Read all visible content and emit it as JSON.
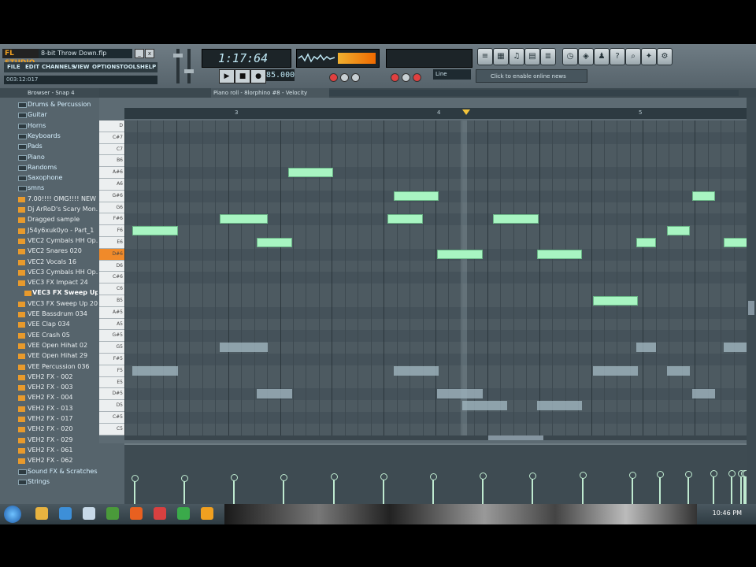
{
  "app": {
    "logo": "FL STUDIO",
    "song_title": "8-bit Throw Down.flp",
    "menu": [
      "FILE",
      "EDIT",
      "CHANNELS",
      "VIEW",
      "OPTIONS",
      "TOOLS",
      "HELP"
    ],
    "time_hint": "003:12:017",
    "time": "1:17:64",
    "tempo": "85.000",
    "line_mode": "Line",
    "online_text": "Click to enable online news"
  },
  "browser": {
    "header": "Browser - Snap 4",
    "items": [
      {
        "label": "Drums & Percussion",
        "type": "folder"
      },
      {
        "label": "Guitar",
        "type": "folder"
      },
      {
        "label": "Horns",
        "type": "folder"
      },
      {
        "label": "Keyboards",
        "type": "folder"
      },
      {
        "label": "Pads",
        "type": "folder"
      },
      {
        "label": "Piano",
        "type": "folder"
      },
      {
        "label": "Randoms",
        "type": "folder"
      },
      {
        "label": "Saxophone",
        "type": "folder"
      },
      {
        "label": "smns",
        "type": "folder"
      },
      {
        "label": "7.00!!!! OMG!!!! NEW ...",
        "type": "file"
      },
      {
        "label": "Dj ArRoD's Scary Mon...",
        "type": "file"
      },
      {
        "label": "Dragged sample",
        "type": "file"
      },
      {
        "label": "J54y6xuk0yo - Part_1",
        "type": "file"
      },
      {
        "label": "VEC2 Cymbals HH Op...",
        "type": "file"
      },
      {
        "label": "VEC2 Snares 020",
        "type": "file"
      },
      {
        "label": "VEC2 Vocals 16",
        "type": "file"
      },
      {
        "label": "VEC3 Cymbals HH Op...",
        "type": "file"
      },
      {
        "label": "VEC3 FX Impact 24",
        "type": "file"
      },
      {
        "label": "VEC3 FX Sweep Up...",
        "type": "file",
        "selected": true
      },
      {
        "label": "VEC3 FX Sweep Up 20",
        "type": "file"
      },
      {
        "label": "VEE Bassdrum 034",
        "type": "file"
      },
      {
        "label": "VEE Clap 034",
        "type": "file"
      },
      {
        "label": "VEE Crash 05",
        "type": "file"
      },
      {
        "label": "VEE Open Hihat 02",
        "type": "file"
      },
      {
        "label": "VEE Open Hihat 29",
        "type": "file"
      },
      {
        "label": "VEE Percussion 036",
        "type": "file"
      },
      {
        "label": "VEH2 FX - 002",
        "type": "file"
      },
      {
        "label": "VEH2 FX - 003",
        "type": "file"
      },
      {
        "label": "VEH2 FX - 004",
        "type": "file"
      },
      {
        "label": "VEH2 FX - 013",
        "type": "file"
      },
      {
        "label": "VEH2 FX - 017",
        "type": "file"
      },
      {
        "label": "VEH2 FX - 020",
        "type": "file"
      },
      {
        "label": "VEH2 FX - 029",
        "type": "file"
      },
      {
        "label": "VEH2 FX - 061",
        "type": "file"
      },
      {
        "label": "VEH2 FX - 062",
        "type": "file"
      },
      {
        "label": "Sound FX & Scratches",
        "type": "folder"
      },
      {
        "label": "Strings",
        "type": "folder"
      }
    ]
  },
  "piano_roll": {
    "title": "Piano roll - 8lorphino #8 - Velocity",
    "ruler": [
      "3",
      "4",
      "5"
    ],
    "keys": [
      {
        "label": "D",
        "black": false
      },
      {
        "label": "C#7",
        "black": true
      },
      {
        "label": "C7",
        "black": false
      },
      {
        "label": "B6",
        "black": false
      },
      {
        "label": "A#6",
        "black": true
      },
      {
        "label": "A6",
        "black": false
      },
      {
        "label": "G#6",
        "black": true
      },
      {
        "label": "G6",
        "black": false
      },
      {
        "label": "F#6",
        "black": true
      },
      {
        "label": "F6",
        "black": false
      },
      {
        "label": "E6",
        "black": false
      },
      {
        "label": "D#6",
        "black": true,
        "active": true
      },
      {
        "label": "D6",
        "black": false
      },
      {
        "label": "C#6",
        "black": true
      },
      {
        "label": "C6",
        "black": false
      },
      {
        "label": "B5",
        "black": false
      },
      {
        "label": "A#5",
        "black": true
      },
      {
        "label": "A5",
        "black": false
      },
      {
        "label": "G#5",
        "black": true
      },
      {
        "label": "G5",
        "black": false
      },
      {
        "label": "F#5",
        "black": true
      },
      {
        "label": "F5",
        "black": false
      },
      {
        "label": "E5",
        "black": false
      },
      {
        "label": "D#5",
        "black": true
      },
      {
        "label": "D5",
        "black": false
      },
      {
        "label": "C#5",
        "black": true
      },
      {
        "label": "C5",
        "black": false
      }
    ],
    "notes": [
      {
        "row": 9,
        "start": 0.0,
        "len": 0.14
      },
      {
        "row": 8,
        "start": 0.14,
        "len": 0.15
      },
      {
        "row": 10,
        "start": 0.2,
        "len": 0.11
      },
      {
        "row": 4,
        "start": 0.25,
        "len": 0.14
      },
      {
        "row": 8,
        "start": 0.41,
        "len": 0.11
      },
      {
        "row": 6,
        "start": 0.42,
        "len": 0.14
      },
      {
        "row": 11,
        "start": 0.49,
        "len": 0.14
      },
      {
        "row": 8,
        "start": 0.58,
        "len": 0.14
      },
      {
        "row": 11,
        "start": 0.65,
        "len": 0.14
      },
      {
        "row": 15,
        "start": 0.74,
        "len": 0.14
      },
      {
        "row": 10,
        "start": 0.81,
        "len": 0.06
      },
      {
        "row": 9,
        "start": 0.86,
        "len": 0.07
      },
      {
        "row": 6,
        "start": 0.9,
        "len": 0.07
      },
      {
        "row": 10,
        "start": 0.95,
        "len": 0.08
      }
    ],
    "ghost_notes": [
      {
        "row": 21,
        "start": 0.0,
        "len": 0.14
      },
      {
        "row": 19,
        "start": 0.14,
        "len": 0.15
      },
      {
        "row": 23,
        "start": 0.2,
        "len": 0.11
      },
      {
        "row": 21,
        "start": 0.42,
        "len": 0.14
      },
      {
        "row": 23,
        "start": 0.49,
        "len": 0.14
      },
      {
        "row": 24,
        "start": 0.53,
        "len": 0.14
      },
      {
        "row": 24,
        "start": 0.65,
        "len": 0.14
      },
      {
        "row": 21,
        "start": 0.74,
        "len": 0.14
      },
      {
        "row": 19,
        "start": 0.81,
        "len": 0.06
      },
      {
        "row": 21,
        "start": 0.86,
        "len": 0.07
      },
      {
        "row": 23,
        "start": 0.9,
        "len": 0.07
      },
      {
        "row": 19,
        "start": 0.95,
        "len": 0.08
      }
    ],
    "playhead": 0.54
  },
  "velocity": [
    0.76,
    0.76,
    0.77,
    0.78,
    0.79,
    0.8,
    0.81,
    0.82,
    0.83,
    0.84,
    0.85,
    0.86,
    0.87,
    0.88,
    0.88,
    0.89,
    0.89,
    0.89
  ],
  "taskbar": {
    "clock": "10:46 PM"
  }
}
